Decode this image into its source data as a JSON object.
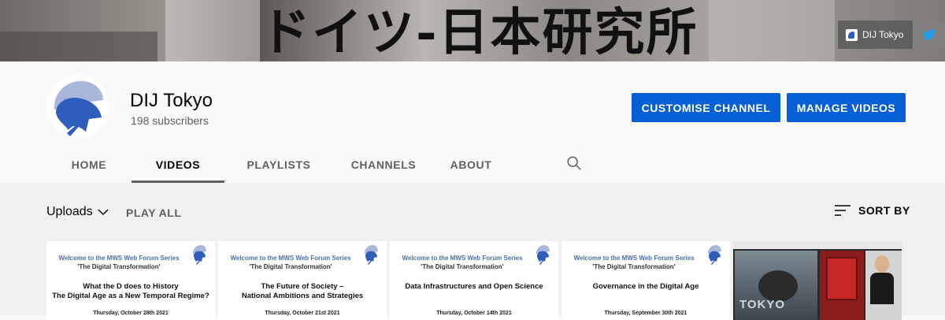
{
  "banner": {
    "title": "ドイツ-日本研究所",
    "link_label": "DIJ Tokyo",
    "link_icon": "site-favicon",
    "social_icon": "twitter-icon"
  },
  "channel": {
    "name": "DIJ Tokyo",
    "subscribers": "198 subscribers",
    "customise_label": "CUSTOMISE CHANNEL",
    "manage_label": "MANAGE VIDEOS"
  },
  "tabs": [
    {
      "label": "HOME",
      "active": false
    },
    {
      "label": "VIDEOS",
      "active": true
    },
    {
      "label": "PLAYLISTS",
      "active": false
    },
    {
      "label": "CHANNELS",
      "active": false
    },
    {
      "label": "ABOUT",
      "active": false
    }
  ],
  "toolbar": {
    "uploads_label": "Uploads",
    "play_all_label": "PLAY ALL",
    "sort_label": "SORT BY"
  },
  "videos": [
    {
      "header1": "Welcome to the MWS Web Forum Series",
      "header2": "'The Digital Transformation'",
      "title_line1": "What the D does to History",
      "title_line2": "The Digital Age as a New Temporal Regime?",
      "date": "Thursday, October 28th 2021"
    },
    {
      "header1": "Welcome to the MWS Web Forum Series",
      "header2": "'The Digital Transformation'",
      "title_line1": "The Future of Society –",
      "title_line2": "National Ambitions and Strategies",
      "date": "Thursday, October 21st 2021"
    },
    {
      "header1": "Welcome to the MWS Web Forum Series",
      "header2": "'The Digital Transformation'",
      "title_line1": "Data Infrastructures and Open Science",
      "title_line2": "",
      "date": "Thursday, October 14th 2021"
    },
    {
      "header1": "Welcome to the MWS Web Forum Series",
      "header2": "'The Digital Transformation'",
      "title_line1": "Governance in the Digital Age",
      "title_line2": "",
      "date": "Thursday, September 30th 2021"
    }
  ],
  "photo_video": {
    "sign_text": "TOKYO"
  },
  "colors": {
    "accent_blue": "#065fd4",
    "logo_blue": "#2f5dbb",
    "logo_light": "#aab7dc"
  }
}
